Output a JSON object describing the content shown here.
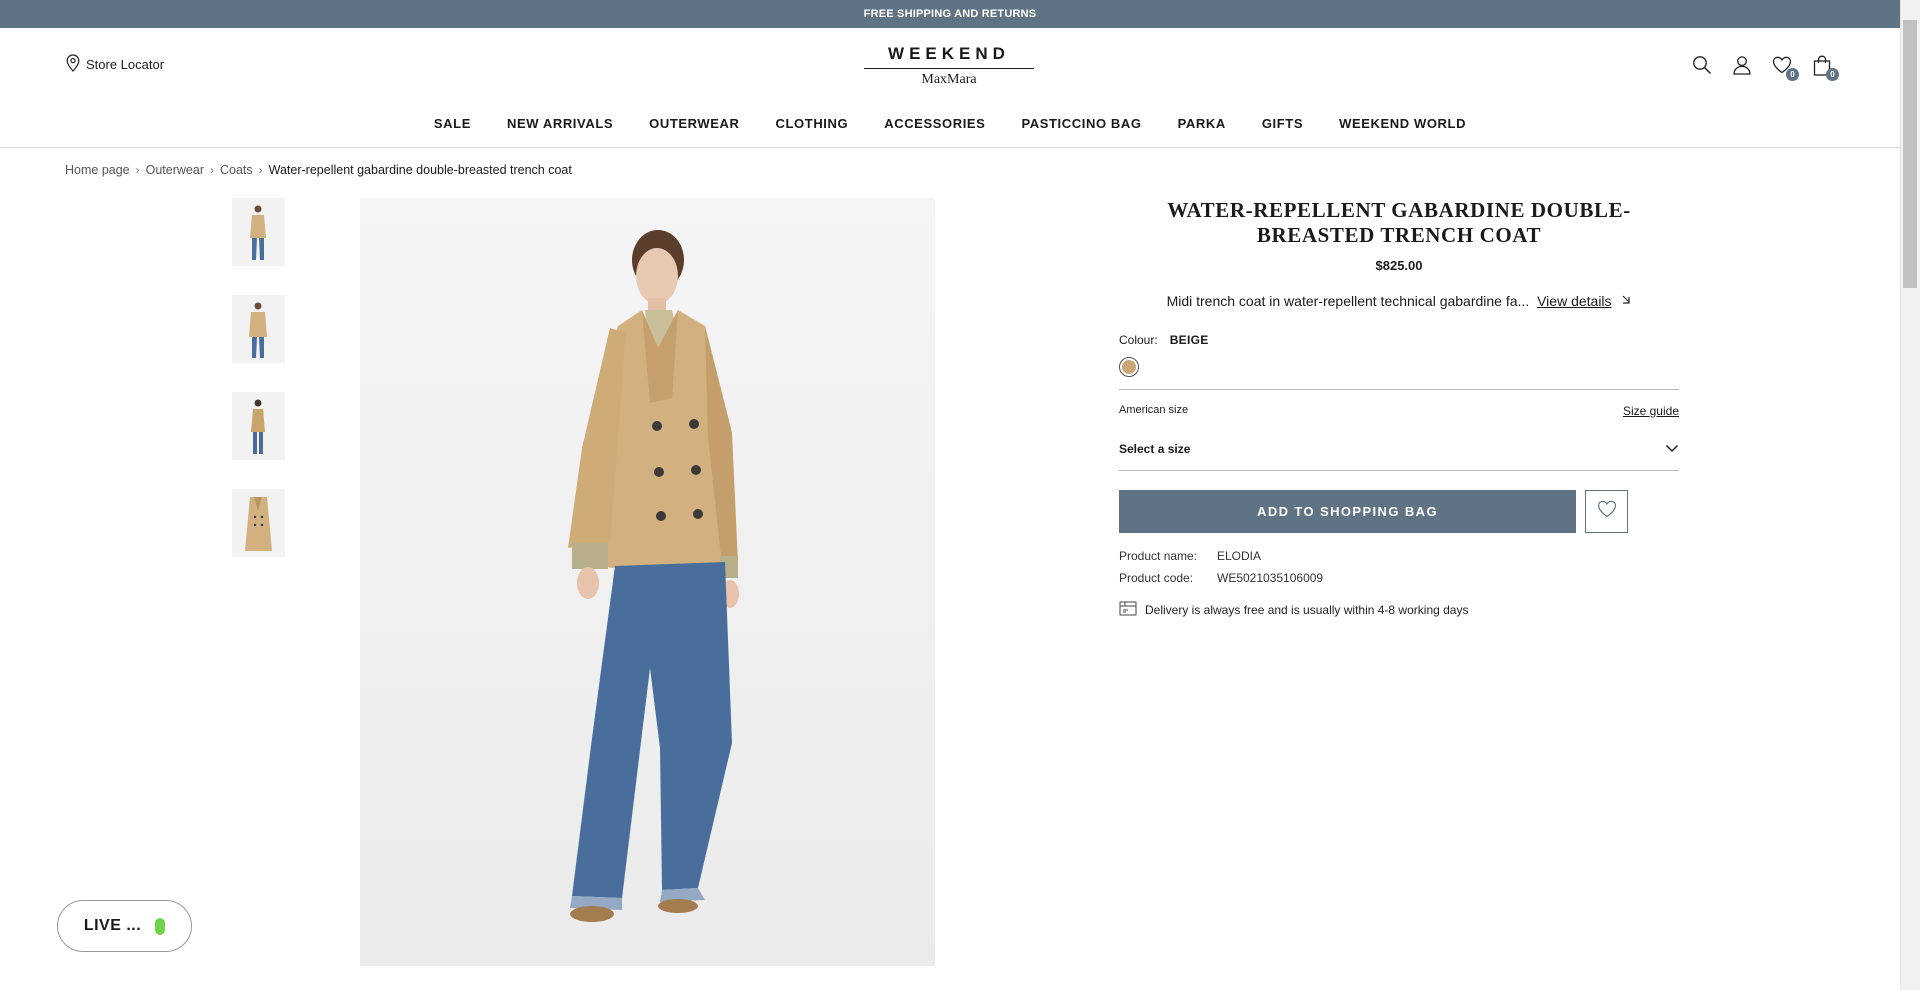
{
  "promo": {
    "text": "FREE SHIPPING AND RETURNS"
  },
  "header": {
    "store_locator": "Store Locator",
    "logo_top": "WEEKEND",
    "logo_bottom": "MaxMara",
    "wishlist_count": "0",
    "cart_count": "0"
  },
  "nav": {
    "items": [
      "SALE",
      "NEW ARRIVALS",
      "OUTERWEAR",
      "CLOTHING",
      "ACCESSORIES",
      "PASTICCINO BAG",
      "PARKA",
      "GIFTS",
      "WEEKEND WORLD"
    ]
  },
  "breadcrumb": {
    "home": "Home page",
    "level1": "Outerwear",
    "level2": "Coats",
    "current": "Water-repellent gabardine double-breasted trench coat"
  },
  "product": {
    "title": "WATER-REPELLENT GABARDINE DOUBLE-BREASTED TRENCH COAT",
    "price": "$825.00",
    "short_description": "Midi trench coat in water-repellent technical gabardine fa...",
    "view_details": "View details",
    "colour_label": "Colour:",
    "colour_value": "BEIGE",
    "swatch_color": "#c9a875",
    "size_system": "American size",
    "size_guide": "Size guide",
    "size_select": "Select a size",
    "add_to_bag": "ADD TO SHOPPING BAG",
    "name_label": "Product name:",
    "name_value": "ELODIA",
    "code_label": "Product code:",
    "code_value": "WE5021035106009",
    "delivery": "Delivery is always free and is usually within 4-8 working days"
  },
  "live": {
    "label": "LIVE ..."
  },
  "colors": {
    "accent": "#5f7384",
    "coat": "#d3b07f",
    "denim": "#4a6e9c",
    "live_dot": "#6fd44a"
  }
}
